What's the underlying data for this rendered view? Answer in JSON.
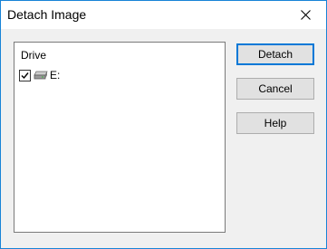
{
  "window": {
    "title": "Detach Image"
  },
  "drive_list": {
    "column_header": "Drive",
    "items": [
      {
        "label": "E:",
        "checked": true,
        "icon": "drive-icon"
      }
    ]
  },
  "buttons": {
    "detach": "Detach",
    "cancel": "Cancel",
    "help": "Help"
  },
  "colors": {
    "window_border": "#1883d7",
    "default_button_border": "#0078d7",
    "dialog_background": "#f0f0f0"
  }
}
